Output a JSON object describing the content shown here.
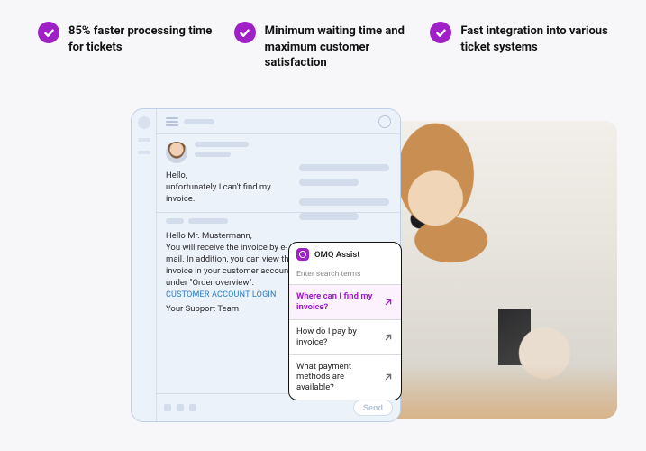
{
  "features": [
    "85% faster processing time for tickets",
    "Minimum waiting time and maximum customer satisfaction",
    "Fast integration into various ticket systems"
  ],
  "chat": {
    "customer_message": "Hello,\nunfortunately I can't find my invoice.",
    "agent_reply": "Hello Mr. Mustermann,\nYou will receive the invoice by e-mail. In addition, you can view the invoice in your customer account under \"Order overview\".",
    "agent_link_label": "CUSTOMER ACCOUNT LOGIN",
    "signature": "Your Support Team",
    "send_label": "Send"
  },
  "assist": {
    "title": "OMQ Assist",
    "search_placeholder": "Enter search terms",
    "suggestions": [
      "Where can I find my invoice?",
      "How do I pay by invoice?",
      "What payment methods are available?"
    ]
  },
  "colors": {
    "accent": "#A020C8",
    "link": "#2E7BC2"
  }
}
